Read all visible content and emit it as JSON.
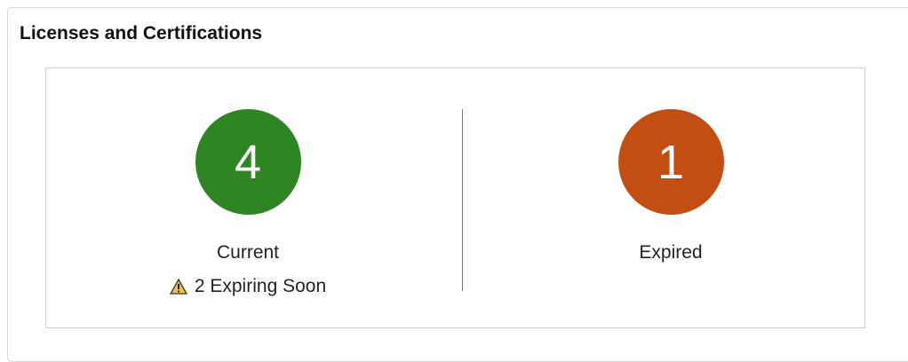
{
  "panel": {
    "title": "Licenses and Certifications"
  },
  "current": {
    "count": "4",
    "label": "Current",
    "warning_text": "2 Expiring Soon",
    "warning_icon": "warning-triangle-icon",
    "color": "#2f8424"
  },
  "expired": {
    "count": "1",
    "label": "Expired",
    "color": "#c24e13"
  }
}
